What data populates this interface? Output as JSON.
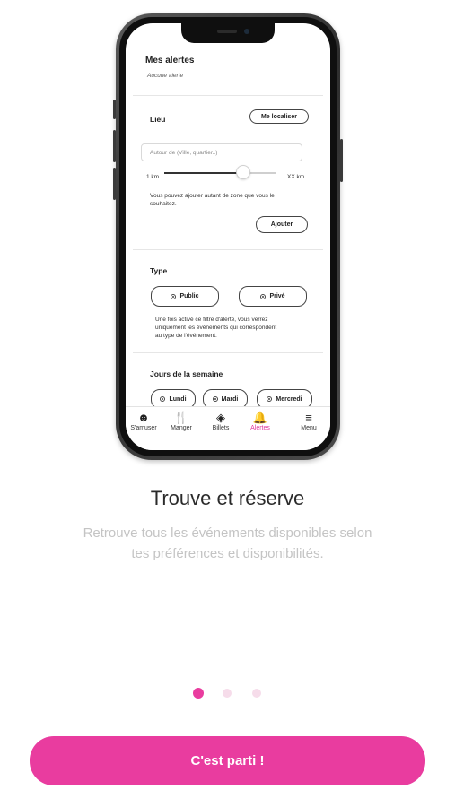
{
  "app": {
    "accent_color": "#e93c9f",
    "inactive_dot_color": "#f6dcea"
  },
  "phone_screen": {
    "alerts": {
      "title": "Mes alertes",
      "empty_text": "Aucune alerte"
    },
    "lieu": {
      "title": "Lieu",
      "locate_button": "Me localiser",
      "input_placeholder": "Autour de (Ville, quartier..)",
      "slider_min_label": "1 km",
      "slider_max_label": "XX km",
      "slider_value": 0.7,
      "help_text_line1": "Vous pouvez ajouter autant de zone que vous le",
      "help_text_line2": "souhaitez.",
      "add_button": "Ajouter"
    },
    "type": {
      "title": "Type",
      "options": [
        "Public",
        "Privé"
      ],
      "help_text_line1": "Une fois activé ce filtre d'alerte, vous verrez",
      "help_text_line2": "uniquement les événements qui correspondent",
      "help_text_line3": "au type de l'événement."
    },
    "days": {
      "title": "Jours de la semaine",
      "options": [
        "Lundi",
        "Mardi",
        "Mercredi"
      ]
    },
    "tabbar": [
      {
        "label": "S'amuser",
        "icon": "smiley-icon"
      },
      {
        "label": "Manger",
        "icon": "fork-knife-icon"
      },
      {
        "label": "Billets",
        "icon": "ticket-icon"
      },
      {
        "label": "Alertes",
        "icon": "bell-icon",
        "active": true
      },
      {
        "label": "Menu",
        "icon": "hamburger-menu-icon"
      }
    ]
  },
  "onboarding": {
    "headline": "Trouve et réserve",
    "subtitle_line1": "Retrouve tous les événements disponibles selon",
    "subtitle_line2": "tes préférences et disponibilités.",
    "page_count": 3,
    "current_page": 1,
    "cta_label": "C'est parti !"
  }
}
